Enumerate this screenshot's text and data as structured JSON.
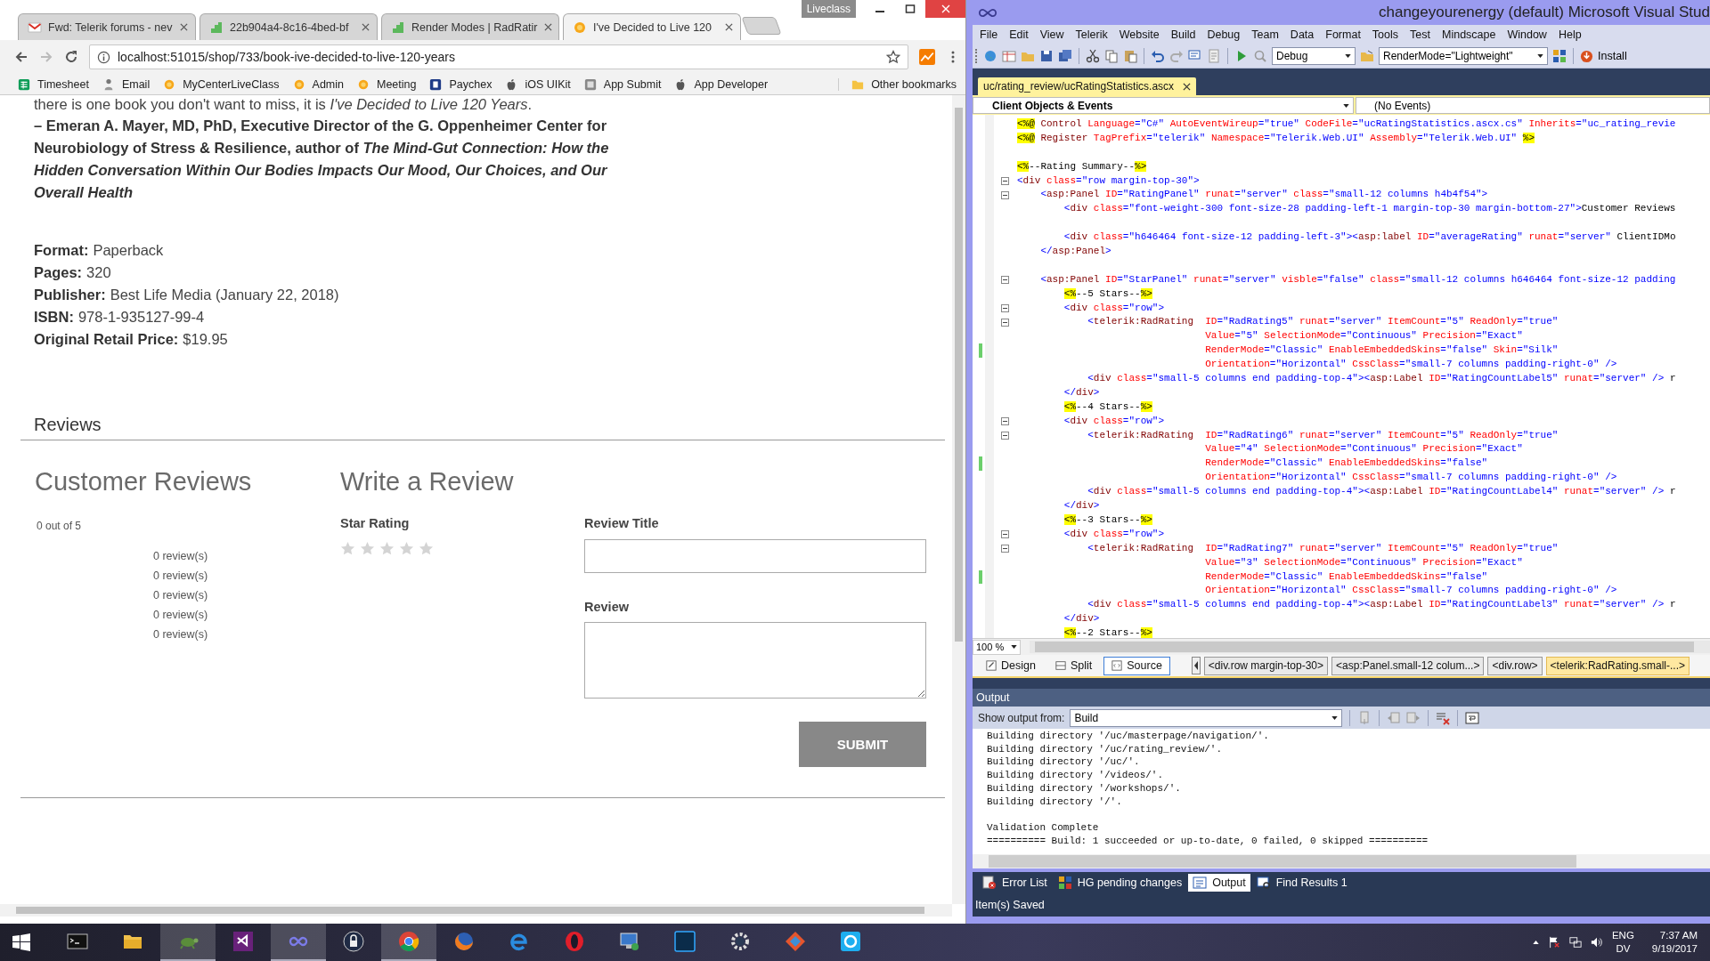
{
  "browser": {
    "tabs": [
      {
        "title": "Fwd: Telerik forums - nev",
        "kind": "mail",
        "selected": false
      },
      {
        "title": "22b904a4-8c16-4bed-bf",
        "kind": "steps",
        "selected": false
      },
      {
        "title": "Render Modes | RadRatir",
        "kind": "steps",
        "selected": false
      },
      {
        "title": "I've Decided to Live 120",
        "kind": "sun",
        "selected": true
      }
    ],
    "badge": "Liveclass",
    "address": "localhost:51015/shop/733/book-ive-decided-to-live-120-years",
    "bookmarks": [
      {
        "label": "Timesheet",
        "kind": "sheet"
      },
      {
        "label": "Email",
        "kind": "figure"
      },
      {
        "label": "MyCenterLiveClass",
        "kind": "sun"
      },
      {
        "label": "Admin",
        "kind": "sun"
      },
      {
        "label": "Meeting",
        "kind": "sun"
      },
      {
        "label": "Paychex",
        "kind": "badge"
      },
      {
        "label": "iOS UIKit",
        "kind": "apple"
      },
      {
        "label": "App Submit",
        "kind": "tile"
      },
      {
        "label": "App Developer",
        "kind": "apple"
      }
    ],
    "other_bookmarks": "Other bookmarks",
    "page": {
      "intro": "there is one book you don't want to miss, it is *I've Decided to Live 120 Years*.",
      "quote": "– Emeran A. Mayer, MD, PhD, Executive Director of the G. Oppenheimer Center for Neurobiology of Stress & Resilience, author of *The Mind-Gut Connection: How the Hidden Conversation Within Our Bodies Impacts Our Mood, Our Choices, and Our Overall Health*",
      "details": [
        {
          "label": "Format:",
          "value": "Paperback"
        },
        {
          "label": "Pages:",
          "value": "320"
        },
        {
          "label": "Publisher:",
          "value": "Best Life Media (January 22, 2018)"
        },
        {
          "label": "ISBN:",
          "value": "978-1-935127-99-4"
        },
        {
          "label": "Original Retail Price:",
          "value": "$19.95"
        }
      ],
      "section_title": "Reviews",
      "summary": {
        "heading": "Customer Reviews",
        "average": "0 out of 5",
        "counts": [
          "0 review(s)",
          "0 review(s)",
          "0 review(s)",
          "0 review(s)",
          "0 review(s)"
        ]
      },
      "form": {
        "heading": "Write a Review",
        "rating_label": "Star Rating",
        "stars": 0,
        "title_label": "Review Title",
        "review_label": "Review",
        "submit": "SUBMIT"
      }
    }
  },
  "ide": {
    "title": "changeyourenergy (default)  Microsoft Visual Stud",
    "menu": [
      "File",
      "Edit",
      "View",
      "Telerik",
      "Website",
      "Build",
      "Debug",
      "Team",
      "Data",
      "Format",
      "Tools",
      "Test",
      "Mindscape",
      "Window",
      "Help"
    ],
    "configuration": "Debug",
    "render_mode": "RenderMode=\"Lightweight\"",
    "install": "Install",
    "document_tab": "uc/rating_review/ucRatingStatistics.ascx",
    "object_list": "Client Objects & Events",
    "event_list": "(No Events)",
    "code": [
      {
        "kind": "line",
        "text": "<%@ Control Language=\"C#\" AutoEventWireup=\"true\" CodeFile=\"ucRatingStatistics.ascx.cs\" Inherits=\"uc_rating_revie",
        "fold": false,
        "changed": false
      },
      {
        "kind": "line",
        "text": "<%@ Register TagPrefix=\"telerik\" Namespace=\"Telerik.Web.UI\" Assembly=\"Telerik.Web.UI\" %>",
        "fold": false,
        "changed": false
      },
      {
        "kind": "blank",
        "fold": false,
        "changed": false
      },
      {
        "kind": "line",
        "text": "<%--Rating Summary--%>",
        "fold": false,
        "changed": false
      },
      {
        "kind": "line",
        "text": "<div class=\"row margin-top-30\">",
        "fold": true,
        "changed": false
      },
      {
        "kind": "line",
        "text": "    <asp:Panel ID=\"RatingPanel\" runat=\"server\" class=\"small-12 columns h4b4f54\">",
        "fold": true,
        "changed": false
      },
      {
        "kind": "line",
        "text": "        <div class=\"font-weight-300 font-size-28 padding-left-1 margin-top-30 margin-bottom-27\">Customer Reviews",
        "fold": false,
        "changed": false
      },
      {
        "kind": "blank",
        "fold": false,
        "changed": false
      },
      {
        "kind": "line",
        "text": "        <div class=\"h646464 font-size-12 padding-left-3\"><asp:label ID=\"averageRating\" runat=\"server\" ClientIDMo",
        "fold": false,
        "changed": false
      },
      {
        "kind": "line",
        "text": "    </asp:Panel>",
        "fold": false,
        "changed": false
      },
      {
        "kind": "blank",
        "fold": false,
        "changed": false
      },
      {
        "kind": "line",
        "text": "    <asp:Panel ID=\"StarPanel\" runat=\"server\" visble=\"false\" class=\"small-12 columns h646464 font-size-12 padding",
        "fold": true,
        "changed": false
      },
      {
        "kind": "line",
        "text": "        <%--5 Stars--%>",
        "fold": false,
        "changed": false
      },
      {
        "kind": "line",
        "text": "        <div class=\"row\">",
        "fold": true,
        "changed": false
      },
      {
        "kind": "line",
        "text": "            <telerik:RadRating  ID=\"RadRating5\" runat=\"server\" ItemCount=\"5\" ReadOnly=\"true\"",
        "fold": true,
        "changed": false
      },
      {
        "kind": "line",
        "text": "                                Value=\"5\" SelectionMode=\"Continuous\" Precision=\"Exact\"",
        "fold": false,
        "changed": false
      },
      {
        "kind": "line",
        "text": "                                RenderMode=\"Classic\" EnableEmbeddedSkins=\"false\" Skin=\"Silk\"",
        "fold": false,
        "changed": true
      },
      {
        "kind": "line",
        "text": "                                Orientation=\"Horizontal\" CssClass=\"small-7 columns padding-right-0\" />",
        "fold": false,
        "changed": false
      },
      {
        "kind": "line",
        "text": "            <div class=\"small-5 columns end padding-top-4\"><asp:Label ID=\"RatingCountLabel5\" runat=\"server\" /> r",
        "fold": false,
        "changed": false
      },
      {
        "kind": "line",
        "text": "        </div>",
        "fold": false,
        "changed": false
      },
      {
        "kind": "line",
        "text": "        <%--4 Stars--%>",
        "fold": false,
        "changed": false
      },
      {
        "kind": "line",
        "text": "        <div class=\"row\">",
        "fold": true,
        "changed": false
      },
      {
        "kind": "line",
        "text": "            <telerik:RadRating  ID=\"RadRating6\" runat=\"server\" ItemCount=\"5\" ReadOnly=\"true\"",
        "fold": true,
        "changed": false
      },
      {
        "kind": "line",
        "text": "                                Value=\"4\" SelectionMode=\"Continuous\" Precision=\"Exact\"",
        "fold": false,
        "changed": false
      },
      {
        "kind": "line",
        "text": "                                RenderMode=\"Classic\" EnableEmbeddedSkins=\"false\"",
        "fold": false,
        "changed": true
      },
      {
        "kind": "line",
        "text": "                                Orientation=\"Horizontal\" CssClass=\"small-7 columns padding-right-0\" />",
        "fold": false,
        "changed": false
      },
      {
        "kind": "line",
        "text": "            <div class=\"small-5 columns end padding-top-4\"><asp:Label ID=\"RatingCountLabel4\" runat=\"server\" /> r",
        "fold": false,
        "changed": false
      },
      {
        "kind": "line",
        "text": "        </div>",
        "fold": false,
        "changed": false
      },
      {
        "kind": "line",
        "text": "        <%--3 Stars--%>",
        "fold": false,
        "changed": false
      },
      {
        "kind": "line",
        "text": "        <div class=\"row\">",
        "fold": true,
        "changed": false
      },
      {
        "kind": "line",
        "text": "            <telerik:RadRating  ID=\"RadRating7\" runat=\"server\" ItemCount=\"5\" ReadOnly=\"true\"",
        "fold": true,
        "changed": false
      },
      {
        "kind": "line",
        "text": "                                Value=\"3\" SelectionMode=\"Continuous\" Precision=\"Exact\"",
        "fold": false,
        "changed": false
      },
      {
        "kind": "line",
        "text": "                                RenderMode=\"Classic\" EnableEmbeddedSkins=\"false\"",
        "fold": false,
        "changed": true
      },
      {
        "kind": "line",
        "text": "                                Orientation=\"Horizontal\" CssClass=\"small-7 columns padding-right-0\" />",
        "fold": false,
        "changed": false
      },
      {
        "kind": "line",
        "text": "            <div class=\"small-5 columns end padding-top-4\"><asp:Label ID=\"RatingCountLabel3\" runat=\"server\" /> r",
        "fold": false,
        "changed": false
      },
      {
        "kind": "line",
        "text": "        </div>",
        "fold": false,
        "changed": false
      },
      {
        "kind": "line",
        "text": "        <%--2 Stars--%>",
        "fold": false,
        "changed": false
      }
    ],
    "zoom": "100 %",
    "views": [
      {
        "label": "Design",
        "kind": "design",
        "selected": false
      },
      {
        "label": "Split",
        "kind": "split",
        "selected": false
      },
      {
        "label": "Source",
        "kind": "source",
        "selected": true
      }
    ],
    "breadcrumbs": [
      {
        "label": "<div.row margin-top-30>",
        "selected": false
      },
      {
        "label": "<asp:Panel.small-12 colum...>",
        "selected": false
      },
      {
        "label": "<div.row>",
        "selected": false
      },
      {
        "label": "<telerik:RadRating.small-...>",
        "selected": true
      }
    ],
    "output": {
      "title": "Output",
      "source_label": "Show output from:",
      "source": "Build",
      "log": [
        "Building directory '/uc/masterpage/navigation/'.",
        "Building directory '/uc/rating_review/'.",
        "Building directory '/uc/'.",
        "Building directory '/videos/'.",
        "Building directory '/workshops/'.",
        "Building directory '/'."
      ],
      "summary": [
        "Validation Complete",
        "========== Build: 1 succeeded or up-to-date, 0 failed, 0 skipped =========="
      ]
    },
    "panel_tabs": [
      {
        "label": "Error List",
        "kind": "error",
        "selected": false
      },
      {
        "label": "HG pending changes",
        "kind": "changes",
        "selected": false
      },
      {
        "label": "Output",
        "kind": "output",
        "selected": true
      },
      {
        "label": "Find Results 1",
        "kind": "find",
        "selected": false
      }
    ],
    "status": "Item(s) Saved"
  },
  "taskbar": {
    "apps": [
      {
        "kind": "terminal",
        "active": false
      },
      {
        "kind": "folder",
        "active": false
      },
      {
        "kind": "turtle",
        "active": true
      },
      {
        "kind": "ribbon",
        "active": false
      },
      {
        "kind": "infinity",
        "active": true
      },
      {
        "kind": "lock",
        "active": false
      },
      {
        "kind": "ring",
        "active": true
      },
      {
        "kind": "fox",
        "active": false
      },
      {
        "kind": "letter-e",
        "active": false
      },
      {
        "kind": "oval",
        "active": false
      },
      {
        "kind": "monitor",
        "active": false
      },
      {
        "kind": "square",
        "active": false
      },
      {
        "kind": "gear",
        "active": false
      },
      {
        "kind": "diamond",
        "active": false
      },
      {
        "kind": "bubble",
        "active": false
      }
    ],
    "language": "ENG",
    "layout": "DV",
    "time": "7:37 AM",
    "date": "9/19/2017"
  }
}
